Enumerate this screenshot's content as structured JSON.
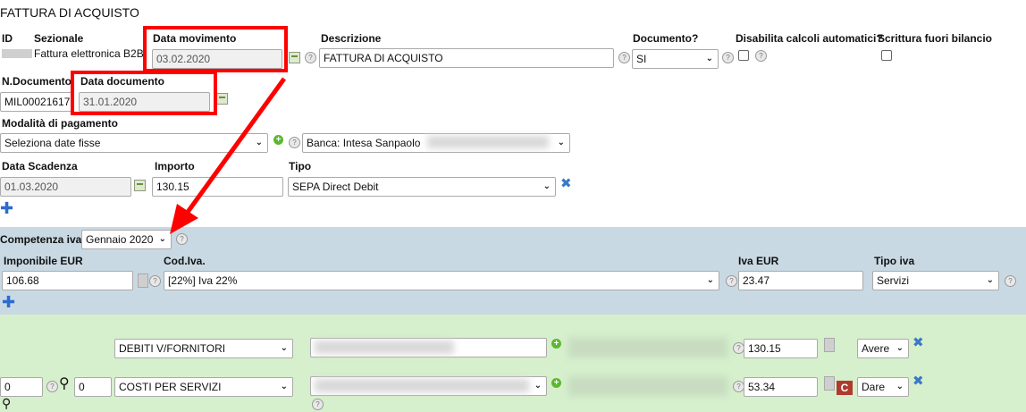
{
  "title": "FATTURA DI ACQUISTO",
  "headers": {
    "id": "ID",
    "sezionale": "Sezionale",
    "data_movimento": "Data movimento",
    "descrizione": "Descrizione",
    "documento": "Documento?",
    "disabilita": "Disabilita calcoli automatici?",
    "scrittura": "Scrittura fuori bilancio"
  },
  "sezionale_value": "Fattura elettronica B2B",
  "data_movimento_value": "03.02.2020",
  "descrizione_value": "FATTURA DI ACQUISTO",
  "documento_value": "SI",
  "ndoc_label": "N.Documento",
  "ndoc_value": "MIL00021617",
  "data_documento_label": "Data documento",
  "data_documento_value": "31.01.2020",
  "modalita_label": "Modalità di pagamento",
  "modalita_value": "Seleziona date fisse",
  "banca_value": "Banca: Intesa Sanpaolo",
  "scadenza": {
    "data_label": "Data Scadenza",
    "importo_label": "Importo",
    "tipo_label": "Tipo",
    "data_value": "01.03.2020",
    "importo_value": "130.15",
    "tipo_value": "SEPA Direct Debit"
  },
  "iva": {
    "competenza_label": "Competenza iva:",
    "competenza_value": "Gennaio 2020",
    "imponibile_label": "Imponibile EUR",
    "codiva_label": "Cod.Iva.",
    "ivaeur_label": "Iva EUR",
    "tipoiva_label": "Tipo iva",
    "imponibile_value": "106.68",
    "codiva_value": "[22%] Iva 22%",
    "ivaeur_value": "23.47",
    "tipoiva_value": "Servizi"
  },
  "rows": [
    {
      "conto": "DEBITI V/FORNITORI",
      "importo": "130.15",
      "segno": "Avere"
    },
    {
      "num1": "0",
      "num2": "0",
      "conto": "COSTI PER SERVIZI",
      "importo": "53.34",
      "segno": "Dare"
    }
  ],
  "colors": {
    "iva_band": "#c9d9e3",
    "rows_band": "#d6efcc",
    "highlight": "#ff0000"
  }
}
